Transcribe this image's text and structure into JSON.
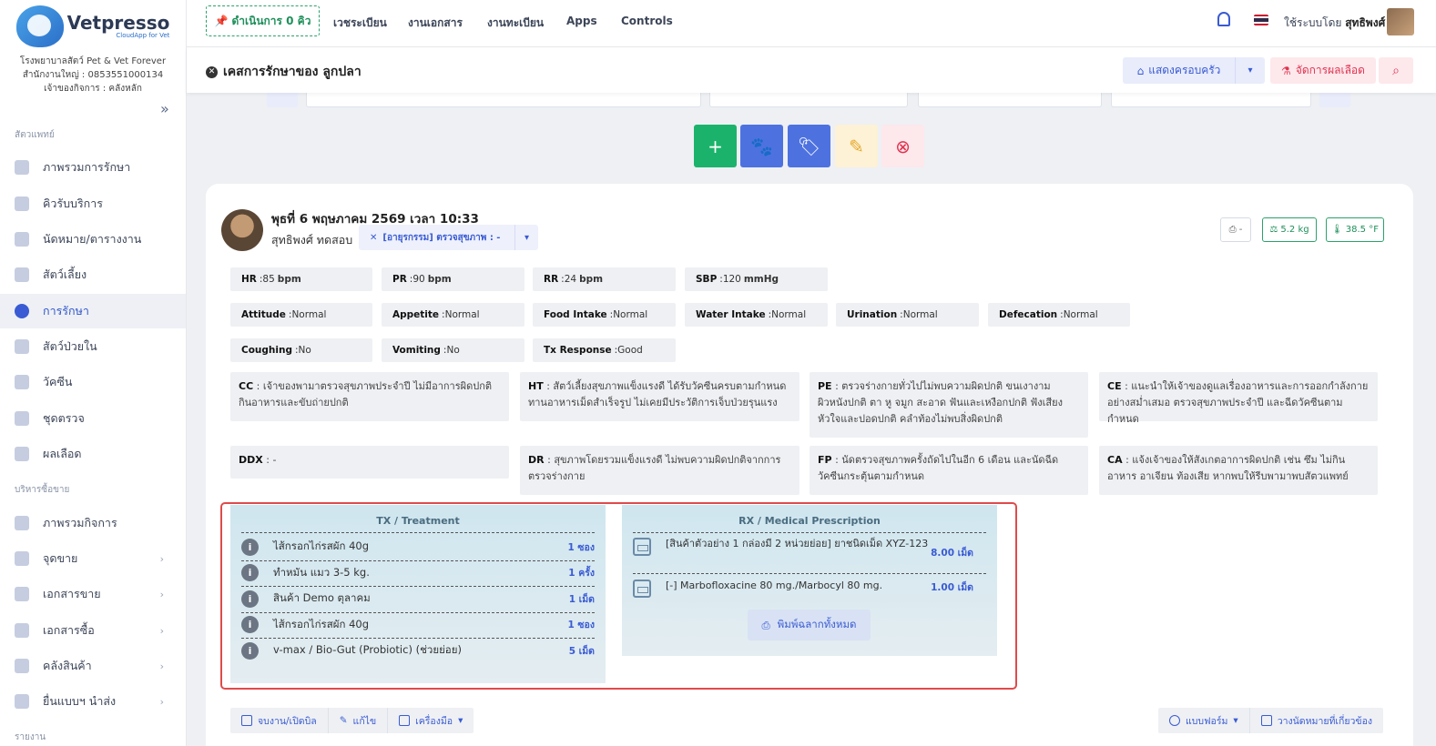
{
  "app": {
    "logo_text": "Vetpresso",
    "logo_sub": "CloudApp for Vet",
    "clinic_name": "โรงพยาบาลสัตว์ Pet & Vet Forever",
    "clinic_phone": "สำนักงานใหญ่ : 0853551000134",
    "clinic_owner": "เจ้าของกิจการ : คลังหลัก"
  },
  "sidebar": {
    "section_vet": "สัตวแพทย์",
    "section_sales": "บริหารซื้อขาย",
    "section_report": "รายงาน",
    "vet_items": [
      {
        "label": "ภาพรวมการรักษา",
        "icon": "treatment-overview-icon"
      },
      {
        "label": "คิวรับบริการ",
        "icon": "queue-icon"
      },
      {
        "label": "นัดหมาย/ตารางงาน",
        "icon": "calendar-icon"
      },
      {
        "label": "สัตว์เลี้ยง",
        "icon": "paw-icon"
      },
      {
        "label": "การรักษา",
        "icon": "treatment-icon"
      },
      {
        "label": "สัตว์ป่วยใน",
        "icon": "inpatient-icon"
      },
      {
        "label": "วัคซีน",
        "icon": "syringe-icon"
      },
      {
        "label": "ชุดตรวจ",
        "icon": "test-kit-icon"
      },
      {
        "label": "ผลเลือด",
        "icon": "flask-icon"
      }
    ],
    "sales_items": [
      {
        "label": "ภาพรวมกิจการ",
        "icon": "business-overview-icon"
      },
      {
        "label": "จุดขาย",
        "icon": "pos-icon"
      },
      {
        "label": "เอกสารขาย",
        "icon": "sales-doc-icon"
      },
      {
        "label": "เอกสารซื้อ",
        "icon": "purchase-doc-icon"
      },
      {
        "label": "คลังสินค้า",
        "icon": "warehouse-icon"
      },
      {
        "label": "ยื่นแบบฯ นำส่ง",
        "icon": "tax-form-icon"
      }
    ]
  },
  "topbar": {
    "queue_label": "ดำเนินการ 0 คิว",
    "nav": [
      "เวชระเบียน",
      "งานเอกสาร",
      "งานทะเบียน",
      "Apps",
      "Controls"
    ],
    "user_prefix": "ใช้ระบบโดย",
    "user_name": "สุทธิพงศ์"
  },
  "subheader": {
    "case_title": "เคสการรักษาของ ลูกปลา",
    "family_btn": "แสดงครอบครัว",
    "blood_btn": "จัดการผลเลือด"
  },
  "visit": {
    "date": "พุธที่ 6 พฤษภาคม 2569 เวลา 10:33",
    "doctor": "สุทธิพงศ์ ทดสอบ",
    "type": "[อายุรกรรม] ตรวจสุขภาพ : -",
    "print_label": "-",
    "weight": "5.2 kg",
    "temperature": "38.5 °F"
  },
  "vitals": [
    {
      "k": "HR",
      "v": "85",
      "u": "bpm"
    },
    {
      "k": "PR",
      "v": "90",
      "u": "bpm"
    },
    {
      "k": "RR",
      "v": "24",
      "u": "bpm"
    },
    {
      "k": "SBP",
      "v": "120",
      "u": "mmHg"
    }
  ],
  "observations": [
    {
      "k": "Attitude",
      "v": "Normal"
    },
    {
      "k": "Appetite",
      "v": "Normal"
    },
    {
      "k": "Food Intake",
      "v": "Normal"
    },
    {
      "k": "Water Intake",
      "v": "Normal"
    },
    {
      "k": "Urination",
      "v": "Normal"
    },
    {
      "k": "Defecation",
      "v": "Normal"
    },
    {
      "k": "Coughing",
      "v": "No"
    },
    {
      "k": "Vomiting",
      "v": "No"
    },
    {
      "k": "Tx Response",
      "v": "Good"
    }
  ],
  "notes": [
    {
      "k": "CC",
      "v": "เจ้าของพามาตรวจสุขภาพประจำปี ไม่มีอาการผิดปกติ กินอาหารและขับถ่ายปกติ"
    },
    {
      "k": "HT",
      "v": "สัตว์เลี้ยงสุขภาพแข็งแรงดี ได้รับวัคซีนครบตามกำหนด ทานอาหารเม็ดสำเร็จรูป ไม่เคยมีประวัติการเจ็บป่วยรุนแรง"
    },
    {
      "k": "PE",
      "v": "ตรวจร่างกายทั่วไปไม่พบความผิดปกติ ขนเงางาม ผิวหนังปกติ ตา หู จมูก สะอาด ฟันและเหงือกปกติ ฟังเสียงหัวใจและปอดปกติ คลำท้องไม่พบสิ่งผิดปกติ"
    },
    {
      "k": "CE",
      "v": "แนะนำให้เจ้าของดูแลเรื่องอาหารและการออกกำลังกายอย่างสม่ำเสมอ ตรวจสุขภาพประจำปี และฉีดวัคซีนตามกำหนด"
    },
    {
      "k": "DDX",
      "v": "-"
    },
    {
      "k": "DR",
      "v": "สุขภาพโดยรวมแข็งแรงดี ไม่พบความผิดปกติจากการตรวจร่างกาย"
    },
    {
      "k": "FP",
      "v": "นัดตรวจสุขภาพครั้งถัดไปในอีก 6 เดือน และนัดฉีดวัคซีนกระตุ้นตามกำหนด"
    },
    {
      "k": "CA",
      "v": "แจ้งเจ้าของให้สังเกตอาการผิดปกติ เช่น ซึม ไม่กินอาหาร อาเจียน ท้องเสีย หากพบให้รีบพามาพบสัตวแพทย์"
    }
  ],
  "treatment": {
    "title": "TX / Treatment",
    "items": [
      {
        "name": "ไส้กรอกไก่รสผัก 40g",
        "qty": "1 ซอง"
      },
      {
        "name": "ทำหมัน แมว 3-5 kg.",
        "qty": "1 ครั้ง"
      },
      {
        "name": "สินค้า Demo ตุลาคม",
        "qty": "1 เม็ด"
      },
      {
        "name": "ไส้กรอกไก่รสผัก 40g",
        "qty": "1 ซอง"
      },
      {
        "name": "v-max / Bio-Gut (Probiotic) (ช่วยย่อย)",
        "qty": "5 เม็ด"
      }
    ]
  },
  "prescription": {
    "title": "RX / Medical Prescription",
    "items": [
      {
        "name": "[สินค้าตัวอย่าง 1 กล่องมี 2 หน่วยย่อย] ยาชนิดเม็ด XYZ-123",
        "qty": "8.00 เม็ด"
      },
      {
        "name": "[-] Marbofloxacine 80 mg./Marbocyl 80 mg.",
        "qty": "1.00 เม็ด"
      }
    ],
    "print_all": "พิมพ์ฉลากทั้งหมด"
  },
  "bottom": {
    "close_bill": "จบงาน/เปิดบิล",
    "edit": "แก้ไข",
    "tools": "เครื่องมือ",
    "forms": "แบบฟอร์ม",
    "appointment": "วางนัดหมายที่เกี่ยวข้อง"
  },
  "colors": {
    "primary": "#3a5bd3",
    "green": "#1bb36b",
    "danger": "#e0334f",
    "frame": "#e04a4a"
  }
}
